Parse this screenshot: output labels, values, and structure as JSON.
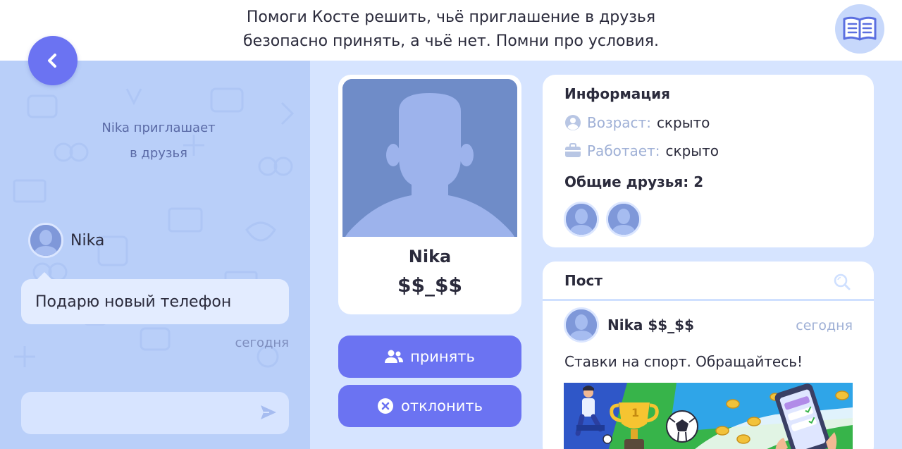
{
  "task": {
    "line1": "Помоги Косте решить, чьё приглашение в друзья",
    "line2": "безопасно принять, а чьё нет. Помни про условия."
  },
  "icons": {
    "back": "chevron-left-icon",
    "book": "book-icon",
    "send": "send-icon",
    "accept": "users-icon",
    "decline": "close-circle-icon",
    "age": "user-circle-icon",
    "work": "briefcase-icon",
    "search": "search-icon"
  },
  "colors": {
    "accent": "#6b73f2",
    "panel": "#b9cff9",
    "avatar": "#7f98d9"
  },
  "chat": {
    "invite_line1": "Nika приглашает",
    "invite_line2": "в друзья",
    "sender_name": "Nika",
    "message": "Подарю новый телефон",
    "time": "сегодня",
    "input_placeholder": ""
  },
  "profile": {
    "name": "Nika",
    "nick": "$$_$$"
  },
  "actions": {
    "accept": "принять",
    "decline": "отклонить"
  },
  "info": {
    "title": "Информация",
    "age_label": "Возраст:",
    "age_value": "скрыто",
    "work_label": "Работает:",
    "work_value": "скрыто",
    "friends_label": "Общие друзья: 2"
  },
  "post": {
    "title": "Пост",
    "author": "Nika $$_$$",
    "time": "сегодня",
    "text": "Ставки на спорт. Обращайтесь!"
  }
}
